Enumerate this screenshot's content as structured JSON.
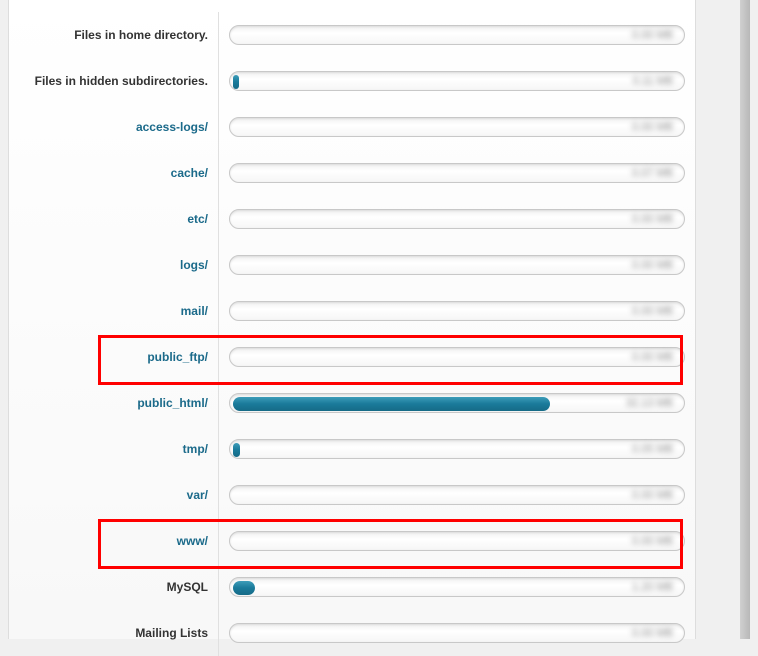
{
  "rows": [
    {
      "label": "Files in home directory.",
      "is_link": false,
      "fill_percent": 0,
      "size": "0.00 MB"
    },
    {
      "label": "Files in hidden subdirectories.",
      "is_link": false,
      "fill_percent": 1.2,
      "size": "0.11 MB"
    },
    {
      "label": "access-logs/",
      "is_link": true,
      "fill_percent": 0,
      "size": "0.00 MB"
    },
    {
      "label": "cache/",
      "is_link": true,
      "fill_percent": 0,
      "size": "0.07 MB"
    },
    {
      "label": "etc/",
      "is_link": true,
      "fill_percent": 0,
      "size": "0.00 MB"
    },
    {
      "label": "logs/",
      "is_link": true,
      "fill_percent": 0,
      "size": "0.00 MB"
    },
    {
      "label": "mail/",
      "is_link": true,
      "fill_percent": 0,
      "size": "0.00 MB"
    },
    {
      "label": "public_ftp/",
      "is_link": true,
      "fill_percent": 0,
      "size": "0.00 MB"
    },
    {
      "label": "public_html/",
      "is_link": true,
      "fill_percent": 72,
      "size": "32.13 MB"
    },
    {
      "label": "tmp/",
      "is_link": true,
      "fill_percent": 1.5,
      "size": "0.05 MB"
    },
    {
      "label": "var/",
      "is_link": true,
      "fill_percent": 0,
      "size": "0.00 MB"
    },
    {
      "label": "www/",
      "is_link": true,
      "fill_percent": 0,
      "size": "0.00 MB"
    },
    {
      "label": "MySQL",
      "is_link": false,
      "fill_percent": 5,
      "size": "1.20 MB"
    },
    {
      "label": "Mailing Lists",
      "is_link": false,
      "fill_percent": 0,
      "size": "0.00 MB"
    }
  ],
  "highlighted_indices": [
    8,
    12
  ]
}
